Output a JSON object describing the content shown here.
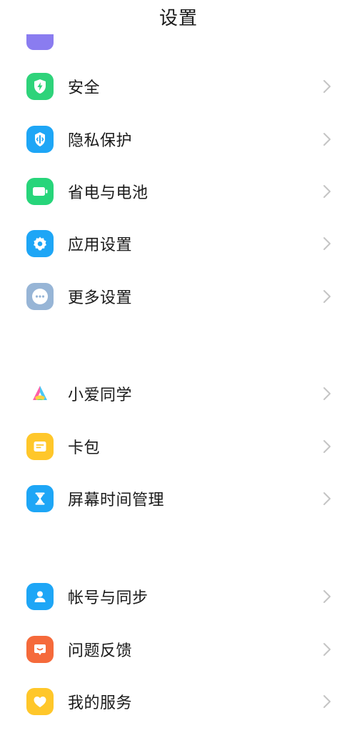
{
  "header": {
    "title": "设置"
  },
  "icons": {
    "security": {
      "name": "shield-bolt-icon",
      "color": "#2ed37a"
    },
    "privacy": {
      "name": "privacy-shield-icon",
      "color": "#1ea6f6"
    },
    "battery": {
      "name": "battery-icon",
      "color": "#27d57a"
    },
    "apps": {
      "name": "gear-icon",
      "color": "#1ea6f6"
    },
    "more": {
      "name": "more-dots-icon",
      "color": "#97b5d6"
    },
    "xiaoai": {
      "name": "xiaoai-assistant-icon",
      "color": "#ffffff"
    },
    "wallet": {
      "name": "card-wallet-icon",
      "color": "#ffc72a"
    },
    "screentime": {
      "name": "hourglass-icon",
      "color": "#1ea6f6"
    },
    "account": {
      "name": "user-icon",
      "color": "#1ea6f6"
    },
    "feedback": {
      "name": "feedback-icon",
      "color": "#f56a3b"
    },
    "services": {
      "name": "heart-icon",
      "color": "#ffc72a"
    }
  },
  "groups": [
    {
      "items": [
        {
          "key": "security",
          "label": "安全"
        },
        {
          "key": "privacy",
          "label": "隐私保护"
        },
        {
          "key": "battery",
          "label": "省电与电池"
        },
        {
          "key": "apps",
          "label": "应用设置"
        },
        {
          "key": "more",
          "label": "更多设置"
        }
      ]
    },
    {
      "items": [
        {
          "key": "xiaoai",
          "label": "小爱同学"
        },
        {
          "key": "wallet",
          "label": "卡包"
        },
        {
          "key": "screentime",
          "label": "屏幕时间管理"
        }
      ]
    },
    {
      "items": [
        {
          "key": "account",
          "label": "帐号与同步"
        },
        {
          "key": "feedback",
          "label": "问题反馈"
        },
        {
          "key": "services",
          "label": "我的服务"
        }
      ]
    }
  ]
}
